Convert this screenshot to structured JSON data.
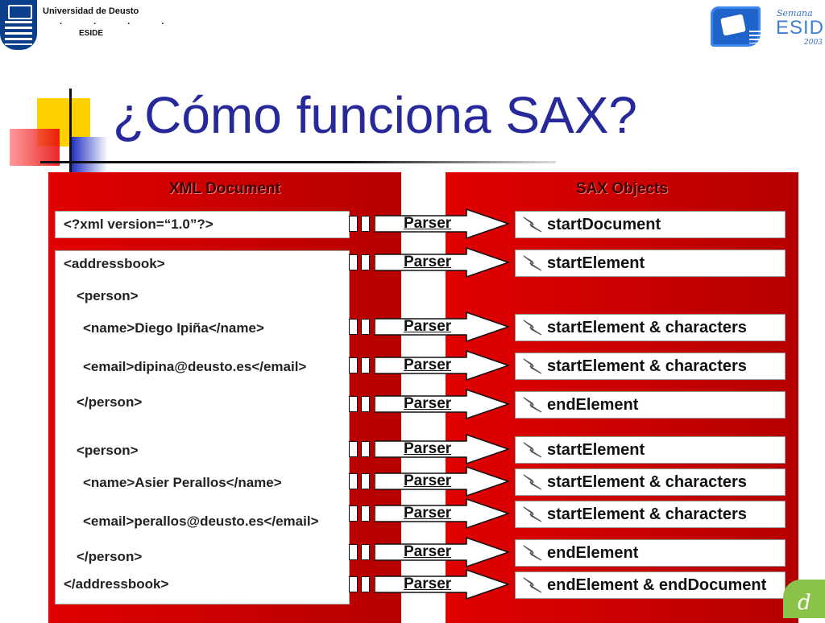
{
  "header": {
    "university": "Universidad de Deusto",
    "dots": ". . . .",
    "faculty": "ESIDE",
    "eside_logo": {
      "script": "Semana",
      "word": "ESIDE",
      "year": "2003"
    }
  },
  "slide": {
    "title": "¿Cómo funciona SAX?",
    "left_heading": "XML Document",
    "right_heading": "SAX Objects",
    "xml_declaration": "<?xml version=“1.0”?>",
    "xml_lines": [
      "<addressbook>",
      "<person>",
      "<name>Diego Ipiña</name>",
      "<email>dipina@deusto.es</email>",
      "</person>",
      "<person>",
      "<name>Asier Perallos</name>",
      "<email>perallos@deusto.es</email>",
      "</person>",
      "</addressbook>"
    ],
    "parser_label": "Parser",
    "sax_events": [
      "startDocument",
      "startElement",
      "startElement & characters",
      "startElement & characters",
      "endElement",
      "startElement",
      "startElement & characters",
      "startElement & characters",
      "endElement",
      "endElement & endDocument"
    ]
  },
  "icons": {
    "event": "lightning-icon"
  },
  "colors": {
    "panel": "#d40000",
    "title": "#27299a"
  }
}
